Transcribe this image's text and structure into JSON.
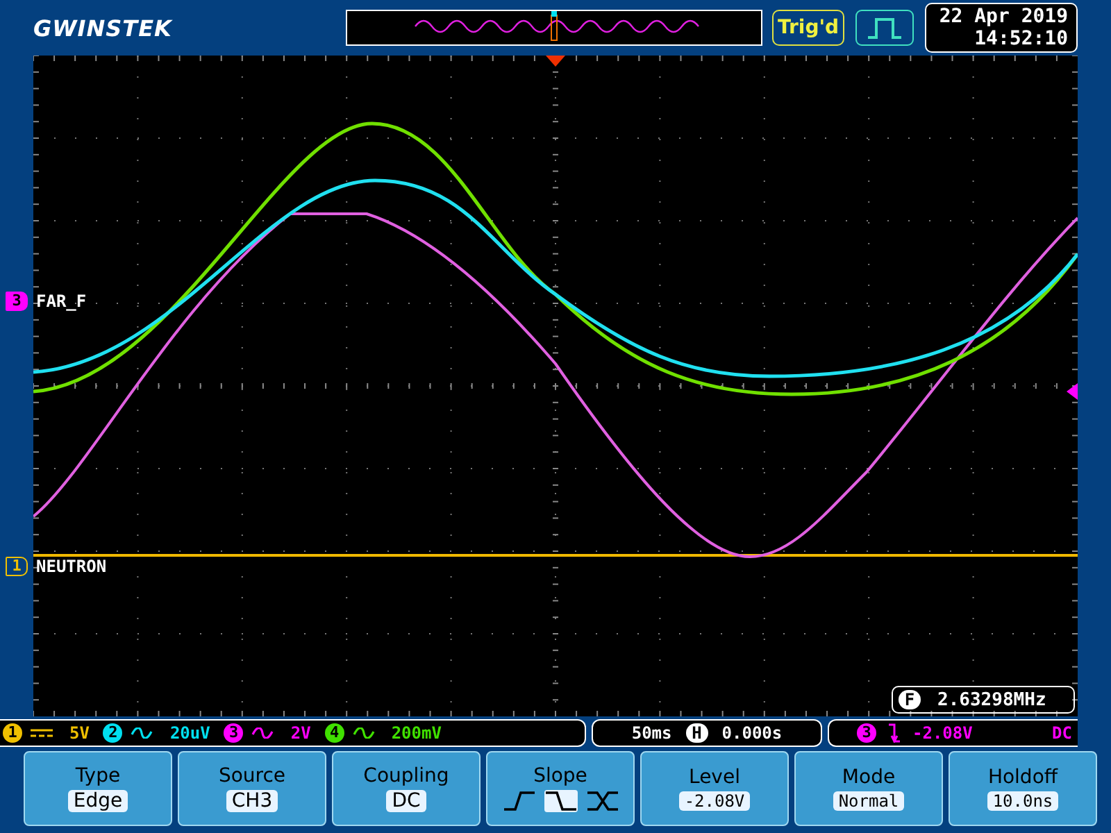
{
  "header": {
    "brand": "GWINSTEK",
    "trigger_status": "Trig'd",
    "date": "22 Apr 2019",
    "time": "14:52:10"
  },
  "markers": [
    {
      "number": "3",
      "label": "FAR_F",
      "color": "#ff00ff",
      "kind": "ch3"
    },
    {
      "number": "1",
      "label": "NEUTRON",
      "color": "#f0c000",
      "kind": "ch1"
    }
  ],
  "frequency": {
    "symbol": "F",
    "value": "2.63298MHz"
  },
  "channels": [
    {
      "number": "1",
      "kind": "dc",
      "scale": "5V",
      "color": "#f0c000"
    },
    {
      "number": "2",
      "kind": "ac",
      "scale": "20uV",
      "color": "#00e0f0"
    },
    {
      "number": "3",
      "kind": "ac",
      "scale": "2V",
      "color": "#ff00ff"
    },
    {
      "number": "4",
      "kind": "ac",
      "scale": "200mV",
      "color": "#40e000"
    }
  ],
  "timebase": {
    "scale": "50ms",
    "symbol": "H",
    "position": "0.000s"
  },
  "trigger": {
    "source_number": "3",
    "color": "#ff00ff",
    "level": "-2.08V",
    "coupling": "DC"
  },
  "menu": [
    {
      "title": "Type",
      "kind": "text",
      "value": "Edge"
    },
    {
      "title": "Source",
      "kind": "text",
      "value": "CH3"
    },
    {
      "title": "Coupling",
      "kind": "text",
      "value": "DC"
    },
    {
      "title": "Slope",
      "kind": "slope",
      "options": [
        {
          "kind": "rising",
          "selected": false
        },
        {
          "kind": "falling",
          "selected": true
        },
        {
          "kind": "either",
          "selected": false
        }
      ]
    },
    {
      "title": "Level",
      "kind": "text",
      "value": "-2.08V"
    },
    {
      "title": "Mode",
      "kind": "text",
      "value": "Normal"
    },
    {
      "title": "Holdoff",
      "kind": "text",
      "value": "10.0ns"
    }
  ]
}
